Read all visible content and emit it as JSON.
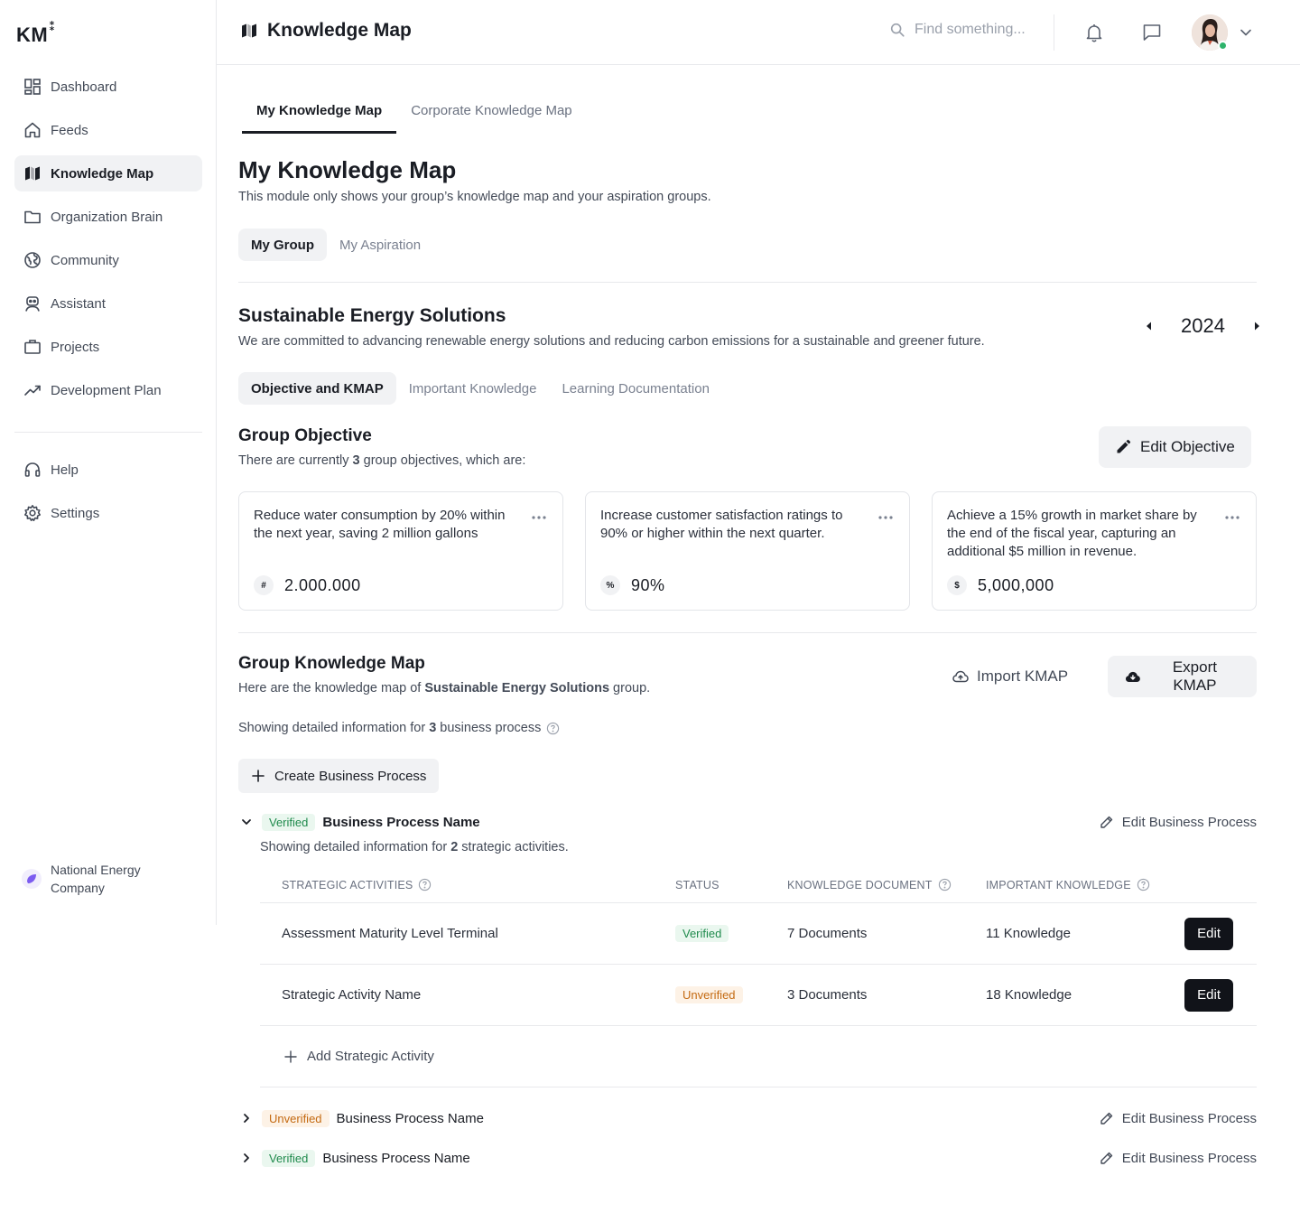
{
  "logo": {
    "text": "KM",
    "mark": "⁑"
  },
  "sidebar": {
    "items": [
      {
        "label": "Dashboard",
        "icon": "dashboard-icon"
      },
      {
        "label": "Feeds",
        "icon": "home-icon"
      },
      {
        "label": "Knowledge Map",
        "icon": "map-icon",
        "active": true
      },
      {
        "label": "Organization Brain",
        "icon": "folder-icon"
      },
      {
        "label": "Community",
        "icon": "globe-icon"
      },
      {
        "label": "Assistant",
        "icon": "robot-icon"
      },
      {
        "label": "Projects",
        "icon": "briefcase-icon"
      },
      {
        "label": "Development Plan",
        "icon": "trend-icon"
      }
    ],
    "secondary": [
      {
        "label": "Help",
        "icon": "headset-icon"
      },
      {
        "label": "Settings",
        "icon": "gear-icon"
      }
    ],
    "company": {
      "name": "National Energy Company",
      "icon": "company-logo-icon",
      "color": "#7c5cf0"
    }
  },
  "header": {
    "title": "Knowledge Map",
    "search_placeholder": "Find something...",
    "icons": [
      "bell-icon",
      "chat-icon",
      "chevron-down-icon"
    ],
    "status_color": "#2fb36b"
  },
  "main": {
    "tabs": [
      "My Knowledge Map",
      "Corporate Knowledge Map"
    ],
    "title": "My Knowledge Map",
    "subtitle": "This module only shows your group’s knowledge map and your aspiration groups.",
    "group_tabs": [
      "My Group",
      "My Aspiration"
    ],
    "group": {
      "name": "Sustainable Energy Solutions",
      "description": "We are committed to advancing renewable energy solutions and reducing carbon emissions for a sustainable and greener future.",
      "year": "2024"
    },
    "section_tabs": [
      "Objective and KMAP",
      "Important Knowledge",
      "Learning Documentation"
    ],
    "objective": {
      "title": "Group Objective",
      "desc_prefix": "There are currently",
      "count": "3",
      "desc_suffix": "group objectives, which are:",
      "edit_label": "Edit Objective",
      "cards": [
        {
          "text": "Reduce water consumption by 20% within the next year, saving 2 million gallons",
          "symbol": "#",
          "value": "2.000.000"
        },
        {
          "text": "Increase customer satisfaction ratings to 90% or higher within the next quarter.",
          "symbol": "%",
          "value": "90%"
        },
        {
          "text": "Achieve a 15% growth in market share by the end of the fiscal year, capturing an additional $5 million in revenue.",
          "symbol": "$",
          "value": "5,000,000"
        }
      ]
    },
    "kmap": {
      "title": "Group Knowledge Map",
      "desc_prefix": "Here are the knowledge map of",
      "group_name": "Sustainable Energy Solutions",
      "desc_suffix": "group.",
      "import_label": "Import KMAP",
      "export_label": "Export KMAP",
      "showing_prefix": "Showing detailed information for",
      "showing_count": "3",
      "showing_suffix": "business process",
      "create_label": "Create Business Process",
      "edit_bp_label": "Edit Business Process",
      "processes": [
        {
          "status": "Verified",
          "name": "Business Process Name",
          "open": true
        },
        {
          "status": "Unverified",
          "name": "Business Process Name",
          "open": false
        },
        {
          "status": "Verified",
          "name": "Business Process Name",
          "open": false
        }
      ],
      "activities_prefix": "Showing detailed information for",
      "activities_count": "2",
      "activities_suffix": "strategic activities.",
      "table": {
        "headers": [
          "STRATEGIC ACTIVITIES",
          "STATUS",
          "KNOWLEDGE DOCUMENT",
          "IMPORTANT KNOWLEDGE"
        ],
        "rows": [
          {
            "activity": "Assessment Maturity Level Terminal",
            "status": "Verified",
            "documents": "7 Documents",
            "knowledge": "11 Knowledge",
            "action": "Edit"
          },
          {
            "activity": "Strategic Activity Name",
            "status": "Unverified",
            "documents": "3 Documents",
            "knowledge": "18 Knowledge",
            "action": "Edit"
          }
        ],
        "add_label": "Add Strategic Activity"
      }
    }
  }
}
